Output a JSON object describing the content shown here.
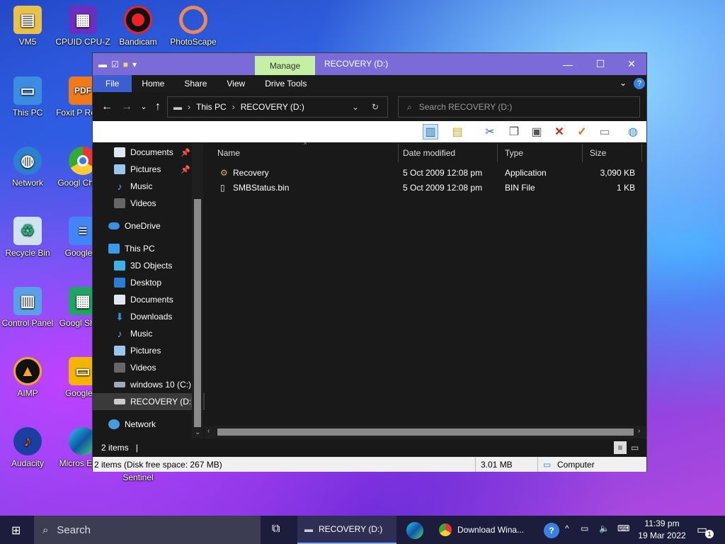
{
  "desktop": {
    "icons": [
      {
        "label": "VM5"
      },
      {
        "label": "CPUID CPU-Z"
      },
      {
        "label": "Bandicam"
      },
      {
        "label": "PhotoScape"
      },
      {
        "label": "This PC"
      },
      {
        "label": "Foxit P Reade"
      },
      {
        "label": "Network"
      },
      {
        "label": "Googl Chrom"
      },
      {
        "label": "Recycle Bin"
      },
      {
        "label": "Google D"
      },
      {
        "label": "Control Panel"
      },
      {
        "label": "Googl Sheet"
      },
      {
        "label": "AIMP"
      },
      {
        "label": "Google S"
      },
      {
        "label": "Audacity"
      },
      {
        "label": "Micros Edge"
      },
      {
        "label": "Sentinel"
      }
    ]
  },
  "window": {
    "title": "RECOVERY (D:)",
    "manage_tab": "Manage",
    "ribbon_tabs": [
      "File",
      "Home",
      "Share",
      "View",
      "Drive Tools"
    ],
    "breadcrumb": [
      "This PC",
      "RECOVERY (D:)"
    ],
    "search_placeholder": "Search RECOVERY (D:)",
    "nav": {
      "quick_access": [
        {
          "label": "Documents",
          "icon": "documents-icon",
          "pinned": true
        },
        {
          "label": "Pictures",
          "icon": "pictures-icon",
          "pinned": true
        },
        {
          "label": "Music",
          "icon": "music-icon"
        },
        {
          "label": "Videos",
          "icon": "videos-icon"
        }
      ],
      "onedrive": "OneDrive",
      "this_pc": "This PC",
      "this_pc_items": [
        {
          "label": "3D Objects",
          "icon": "3d-objects-icon"
        },
        {
          "label": "Desktop",
          "icon": "desktop-icon"
        },
        {
          "label": "Documents",
          "icon": "documents-icon"
        },
        {
          "label": "Downloads",
          "icon": "downloads-icon"
        },
        {
          "label": "Music",
          "icon": "music-icon"
        },
        {
          "label": "Pictures",
          "icon": "pictures-icon"
        },
        {
          "label": "Videos",
          "icon": "videos-icon"
        },
        {
          "label": "windows 10 (C:)",
          "icon": "drive-c-icon"
        },
        {
          "label": "RECOVERY (D:)",
          "icon": "drive-d-icon",
          "selected": true
        }
      ],
      "network": "Network"
    },
    "columns": [
      "Name",
      "Date modified",
      "Type",
      "Size"
    ],
    "files": [
      {
        "name": "Recovery",
        "date": "5 Oct 2009 12:08 pm",
        "type": "Application",
        "size": "3,090 KB",
        "icon": "application-icon"
      },
      {
        "name": "SMBStatus.bin",
        "date": "5 Oct 2009 12:08 pm",
        "type": "BIN File",
        "size": "1 KB",
        "icon": "file-icon"
      }
    ],
    "status_count": "2 items",
    "status_detail": "2 items (Disk free space: 267 MB)",
    "status_size": "3.01 MB",
    "status_location": "Computer"
  },
  "taskbar": {
    "search_placeholder": "Search",
    "explorer_label": "RECOVERY (D:)",
    "chrome_label": "Download Wina...",
    "time": "11:39 pm",
    "date": "19 Mar 2022",
    "notification_count": "1"
  },
  "colors": {
    "titlebar": "#7a6bd8",
    "manage_tab": "#c6efa6",
    "file_tab": "#3b5fd0",
    "window_bg": "#191919"
  }
}
